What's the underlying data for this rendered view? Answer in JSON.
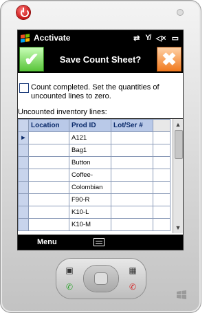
{
  "taskbar": {
    "app_title": "Acctivate",
    "tray_icons": [
      "sync-icon",
      "signal-off-icon",
      "speaker-muted-icon",
      "battery-icon"
    ]
  },
  "header": {
    "title": "Save Count Sheet?",
    "ok_icon": "checkmark-icon",
    "cancel_icon": "x-icon"
  },
  "checkbox": {
    "label": "Count completed.  Set the quantities of uncounted lines to zero.",
    "checked": false
  },
  "uncounted_label": "Uncounted inventory lines:",
  "table": {
    "columns": [
      "Location",
      "Prod ID",
      "Lot/Ser #"
    ],
    "selected_row": 0,
    "row_marker": "►",
    "rows": [
      {
        "location": "",
        "prod_id": "A121",
        "lot": ""
      },
      {
        "location": "",
        "prod_id": "Bag1",
        "lot": ""
      },
      {
        "location": "",
        "prod_id": "Button",
        "lot": ""
      },
      {
        "location": "",
        "prod_id": "Coffee-",
        "lot": ""
      },
      {
        "location": "",
        "prod_id": "Colombian",
        "lot": ""
      },
      {
        "location": "",
        "prod_id": "F90-R",
        "lot": ""
      },
      {
        "location": "",
        "prod_id": "K10-L",
        "lot": ""
      },
      {
        "location": "",
        "prod_id": "K10-M",
        "lot": ""
      }
    ]
  },
  "menubar": {
    "menu_label": "Menu",
    "keyboard_icon": "keyboard-icon"
  },
  "colors": {
    "accept": "#59c43a",
    "cancel": "#f07a20",
    "header_bg": "#000000",
    "grid_header": "#b9c9e8"
  }
}
